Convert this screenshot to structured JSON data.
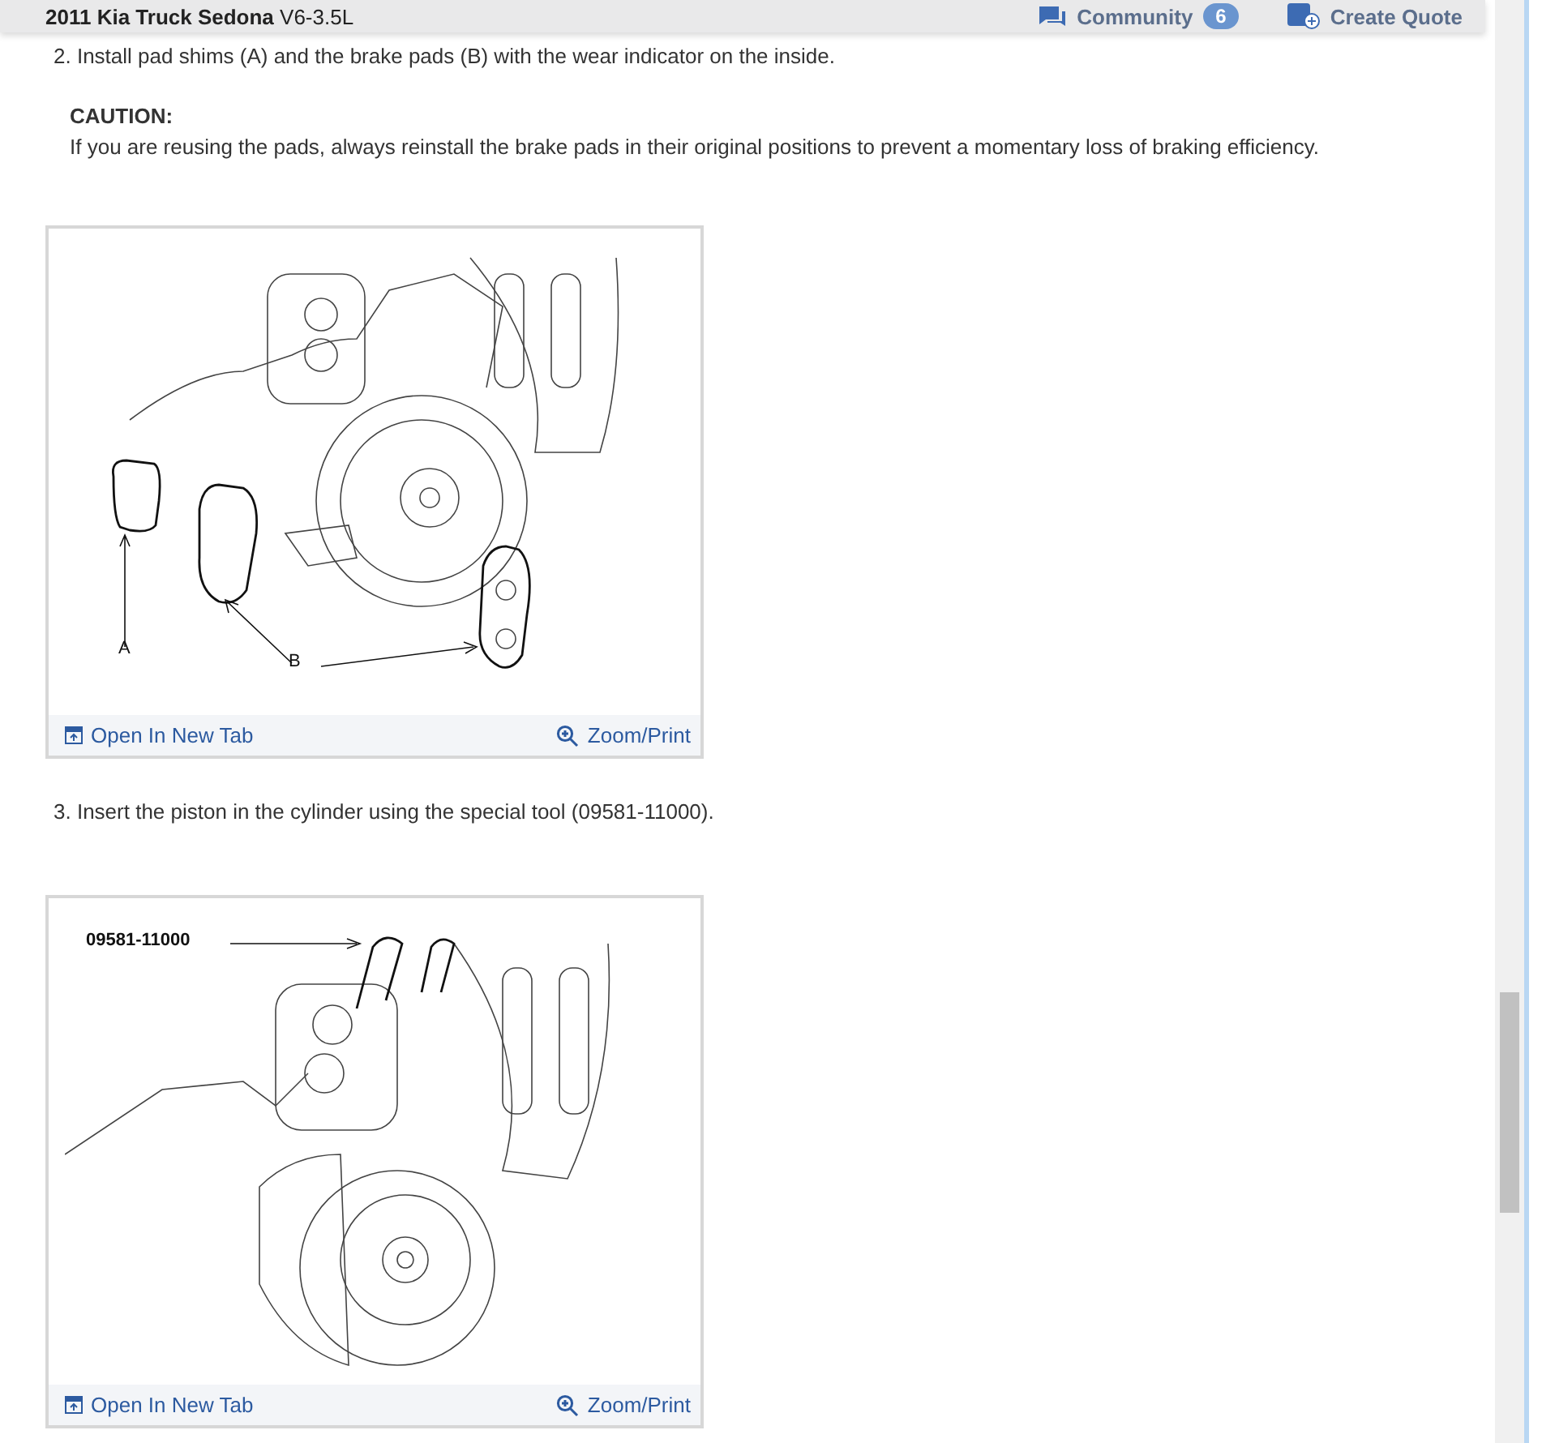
{
  "header": {
    "vehicle": "2011 Kia Truck Sedona",
    "engine": "V6-3.5L",
    "community": {
      "label": "Community",
      "count": "6"
    },
    "quote": {
      "label": "Create Quote"
    }
  },
  "steps": [
    {
      "text": "2. Install pad shims (A) and the brake pads (B) with the wear indicator on the inside.",
      "caution": {
        "title": "CAUTION:",
        "text": "If you are reusing the pads, always reinstall the brake pads in their original positions to prevent a momentary loss of braking efficiency."
      },
      "figure": {
        "kind": "pads",
        "labels": [
          "A",
          "B"
        ],
        "open_link": "Open In New Tab",
        "zoom_link": "Zoom/Print"
      }
    },
    {
      "text": "3. Insert the piston in the cylinder using the special tool (09581-11000).",
      "figure": {
        "kind": "tool",
        "labels": [
          "09581-11000"
        ],
        "open_link": "Open In New Tab",
        "zoom_link": "Zoom/Print"
      }
    }
  ]
}
